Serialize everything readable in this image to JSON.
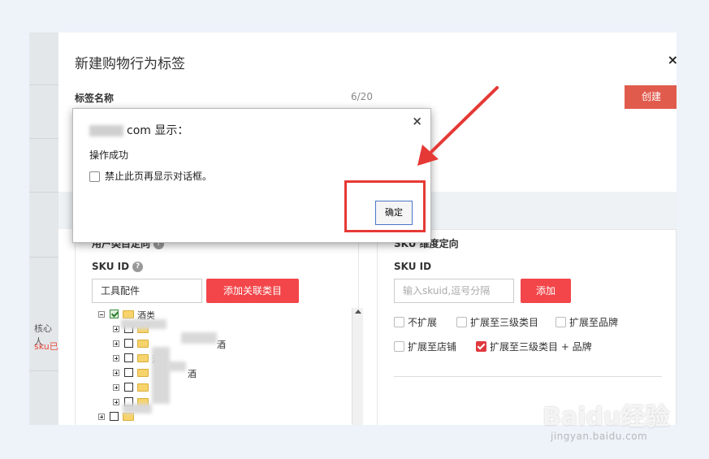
{
  "modal": {
    "title": "新建购物行为标签",
    "close": "×",
    "label_name": "标签名称",
    "counter": "6/20",
    "create_label": "创建"
  },
  "left_strip": {
    "text1": "核心人",
    "text2": "sku已"
  },
  "left_panel": {
    "heading": "用户类目定向",
    "sku_label": "SKU ID",
    "help": "?",
    "input_value": "工具配件",
    "add_button": "添加关联类目",
    "tree": {
      "root_label": "酒类",
      "child_suffix_1": "酒",
      "child_suffix_2": "酒",
      "child_suffix_3": "酒"
    }
  },
  "right_panel": {
    "heading": "SKU 维度定向",
    "sku_label": "SKU ID",
    "input_placeholder": "输入skuid,逗号分隔",
    "add_button": "添加",
    "options": [
      {
        "label": "不扩展",
        "checked": false
      },
      {
        "label": "扩展至三级类目",
        "checked": false
      },
      {
        "label": "扩展至品牌",
        "checked": false
      },
      {
        "label": "扩展至店铺",
        "checked": false
      },
      {
        "label": "扩展至三级类目 + 品牌",
        "checked": true
      }
    ]
  },
  "dialog": {
    "title_suffix": "com 显示：",
    "close": "×",
    "message": "操作成功",
    "suppress_label": "禁止此页再显示对话框。",
    "ok_label": "确定"
  },
  "annotation": {
    "color": "#e53935"
  },
  "watermark": {
    "text": "Baidu经验",
    "sub": "jingyan.baidu.com"
  }
}
